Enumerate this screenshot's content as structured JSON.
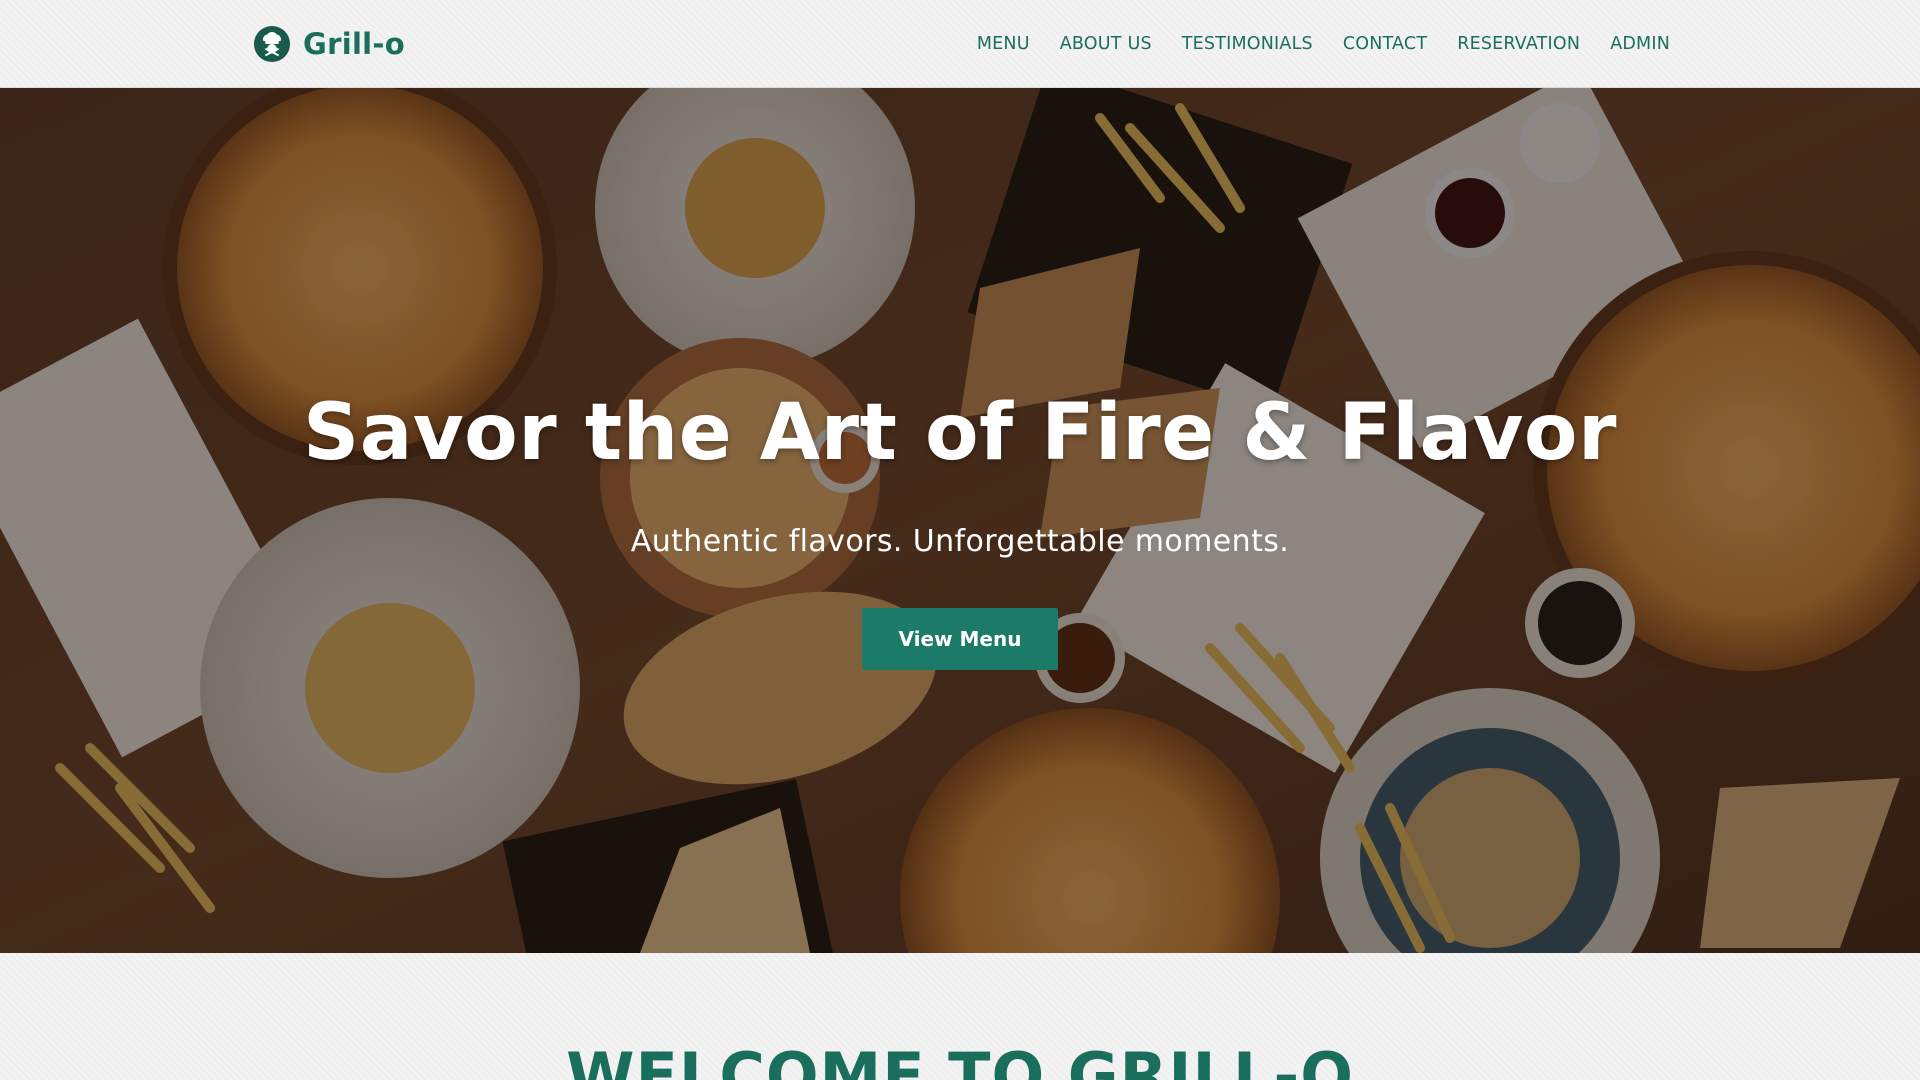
{
  "brand": {
    "name": "Grill-o",
    "logo_icon": "chef-icon"
  },
  "nav": {
    "items": [
      {
        "label": "MENU"
      },
      {
        "label": "ABOUT US"
      },
      {
        "label": "TESTIMONIALS"
      },
      {
        "label": "CONTACT"
      },
      {
        "label": "RESERVATION"
      },
      {
        "label": "ADMIN"
      }
    ]
  },
  "hero": {
    "title": "Savor the Art of Fire & Flavor",
    "subtitle": "Authentic flavors. Unforgettable moments.",
    "button_label": "View Menu",
    "background": "food-table-photo"
  },
  "welcome": {
    "title": "WELCOME TO GRILL-O"
  },
  "colors": {
    "accent": "#1b7a68",
    "brand_text": "#1a6e5c",
    "header_bg": "#f3f3f3",
    "hero_text": "#ffffff"
  }
}
